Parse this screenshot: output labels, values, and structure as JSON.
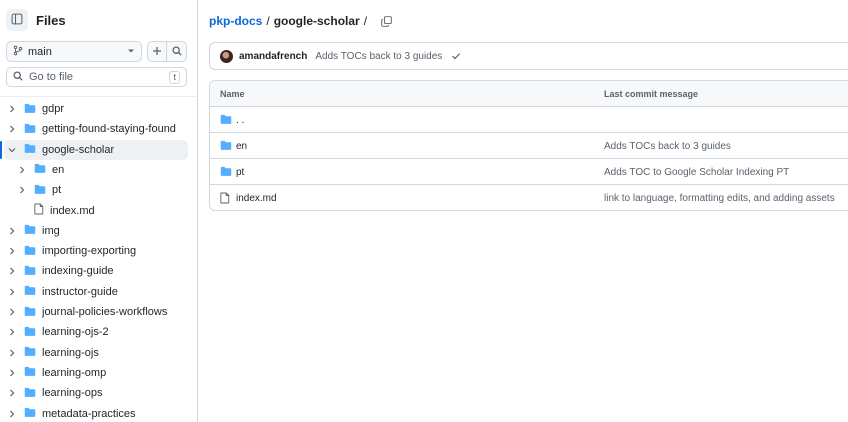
{
  "colors": {
    "accent": "#0969da",
    "folder": "#54aeff",
    "border": "#d0d7de",
    "muted": "#59636e"
  },
  "sidebar": {
    "title": "Files",
    "branch": "main",
    "goto_placeholder": "Go to file",
    "goto_shortcut": "t",
    "tree": [
      {
        "label": "gdpr",
        "type": "folder",
        "depth": 0,
        "expanded": false
      },
      {
        "label": "getting-found-staying-found",
        "type": "folder",
        "depth": 0,
        "expanded": false
      },
      {
        "label": "google-scholar",
        "type": "folder",
        "depth": 0,
        "expanded": true,
        "active": true
      },
      {
        "label": "en",
        "type": "folder",
        "depth": 1,
        "expanded": false
      },
      {
        "label": "pt",
        "type": "folder",
        "depth": 1,
        "expanded": false
      },
      {
        "label": "index.md",
        "type": "file",
        "depth": 1
      },
      {
        "label": "img",
        "type": "folder",
        "depth": 0,
        "expanded": false
      },
      {
        "label": "importing-exporting",
        "type": "folder",
        "depth": 0,
        "expanded": false
      },
      {
        "label": "indexing-guide",
        "type": "folder",
        "depth": 0,
        "expanded": false
      },
      {
        "label": "instructor-guide",
        "type": "folder",
        "depth": 0,
        "expanded": false
      },
      {
        "label": "journal-policies-workflows",
        "type": "folder",
        "depth": 0,
        "expanded": false
      },
      {
        "label": "learning-ojs-2",
        "type": "folder",
        "depth": 0,
        "expanded": false
      },
      {
        "label": "learning-ojs",
        "type": "folder",
        "depth": 0,
        "expanded": false
      },
      {
        "label": "learning-omp",
        "type": "folder",
        "depth": 0,
        "expanded": false
      },
      {
        "label": "learning-ops",
        "type": "folder",
        "depth": 0,
        "expanded": false
      },
      {
        "label": "metadata-practices",
        "type": "folder",
        "depth": 0,
        "expanded": false
      }
    ]
  },
  "breadcrumb": {
    "repo": "pkp-docs",
    "sep1": "/",
    "current": "google-scholar",
    "sep2": "/"
  },
  "commit": {
    "author": "amandafrench",
    "message": "Adds TOCs back to 3 guides"
  },
  "files": {
    "headers": {
      "name": "Name",
      "message": "Last commit message"
    },
    "rows": [
      {
        "name": ". .",
        "type": "folder",
        "message": ""
      },
      {
        "name": "en",
        "type": "folder",
        "message": "Adds TOCs back to 3 guides"
      },
      {
        "name": "pt",
        "type": "folder",
        "message": "Adds TOC to Google Scholar Indexing PT"
      },
      {
        "name": "index.md",
        "type": "file",
        "message": "link to language, formatting edits, and adding assets"
      }
    ]
  }
}
